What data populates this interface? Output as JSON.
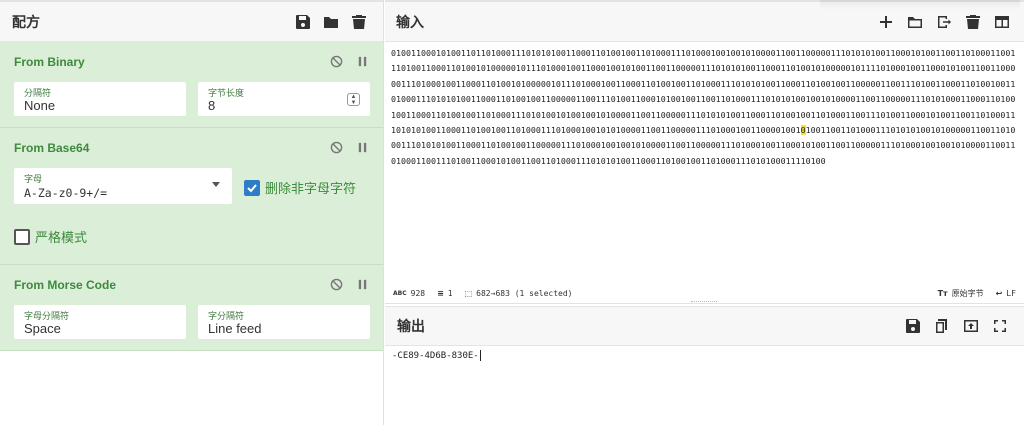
{
  "recipe": {
    "title": "配方",
    "icons": [
      "save-icon",
      "folder-icon",
      "trash-icon"
    ],
    "operations": [
      {
        "name": "From Binary",
        "fields": [
          {
            "label": "分隔符",
            "value": "None"
          },
          {
            "label": "字节长度",
            "value": "8"
          }
        ]
      },
      {
        "name": "From Base64",
        "fields": [
          {
            "label": "字母",
            "value": "A-Za-z0-9+/="
          }
        ],
        "checkbox_remove": {
          "label": "删除非字母字符",
          "checked": true
        },
        "checkbox_strict": {
          "label": "严格模式",
          "checked": false
        }
      },
      {
        "name": "From Morse Code",
        "fields": [
          {
            "label": "字母分隔符",
            "value": "Space"
          },
          {
            "label": "字分隔符",
            "value": "Line feed"
          }
        ]
      }
    ]
  },
  "input": {
    "title": "输入",
    "icons": [
      "plus-icon",
      "folder-icon",
      "import-icon",
      "trash-icon",
      "layout-icon"
    ],
    "text_before": "01001100010100110110100011101010100110001101001001101000111010001001001010000110011000001110101010011000101001100110100011001110100110001101001010000010111010001001100010010100110011000001110101010011000110100101000001011110100010011000101001100110000011101000100110001101001010000010111010001001100011010010011010001110101010011000110100100110000011001110100110001101001001101000111010101001100011010010011000001100111010011000101001001100110100011101010100100101000011001100000111010100011000110100100110001101001001101000111010100101001001010000110011000001110101010011000110100100110100011001110100110001010011001101000111010101001100011010010011010001110100010010101000011001100000111010001001100001001",
    "text_highlight": "0",
    "text_after": "10011001101000111010101001010000011001101000111010101001100011010010011000001110100010010010100001100110000011101000100110001010011001100000111010001001001010000110011010001100111010011000101001100110100011101010100110001101001001101000111010100011110100",
    "status": {
      "chars": "928",
      "lines": "1",
      "selection": "682→683 (1 selected)",
      "encoding": "原始字节",
      "eol": "LF"
    }
  },
  "output": {
    "title": "输出",
    "icons": [
      "save-icon",
      "copy-icon",
      "replace-input-icon",
      "maximize-icon"
    ],
    "text": "-CE89-4D6B-830E-"
  }
}
